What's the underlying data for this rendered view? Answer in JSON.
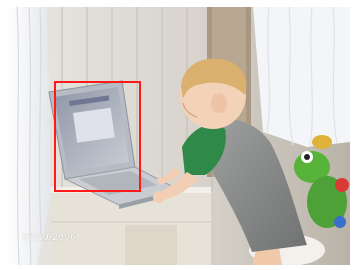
{
  "photo": {
    "date_stamp": "07/19/2006",
    "highlight_color": "#ff1a1a"
  }
}
